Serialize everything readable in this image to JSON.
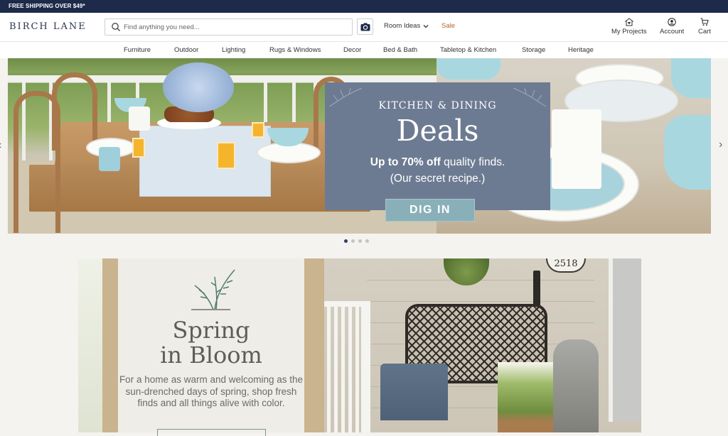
{
  "topbar": {
    "shipping_text": "FREE SHIPPING OVER $49*"
  },
  "header": {
    "logo": "BIRCH LANE",
    "search": {
      "placeholder": "Find anything you need...",
      "value": "",
      "icon": "search-icon"
    },
    "camera_icon": "camera-icon",
    "room_ideas": {
      "label": "Room Ideas",
      "icon": "chevron-down-icon"
    },
    "sale_label": "Sale",
    "utilities": [
      {
        "label": "My Projects",
        "icon": "heart-house-icon"
      },
      {
        "label": "Account",
        "icon": "user-circle-icon"
      },
      {
        "label": "Cart",
        "icon": "cart-icon"
      }
    ],
    "accent_color": "#b5662a"
  },
  "nav": {
    "items": [
      "Furniture",
      "Outdoor",
      "Lighting",
      "Rugs & Windows",
      "Decor",
      "Bed & Bath",
      "Tabletop & Kitchen",
      "Storage",
      "Heritage"
    ]
  },
  "hero": {
    "kicker": "KITCHEN & DINING",
    "headline": "Deals",
    "line1_bold": "Up to 70% off",
    "line1_rest": " quality finds.",
    "line2": "(Our secret recipe.)",
    "cta": "DIG IN",
    "prev_icon": "chevron-left-icon",
    "next_icon": "chevron-right-icon",
    "slides_total": 4,
    "active_slide": 1,
    "panel_color": "#6d7b92",
    "cta_color": "#89b0b8"
  },
  "spring": {
    "title_line1": "Spring",
    "title_line2": "in Bloom",
    "body": "For a home as warm and welcoming as the sun-drenched days of spring, shop fresh finds and all things alive with color.",
    "address_number": "2518"
  },
  "colors": {
    "topbar": "#1d2a4a",
    "dot_active": "#2e4066",
    "dot_inactive": "#c4c4c4"
  }
}
